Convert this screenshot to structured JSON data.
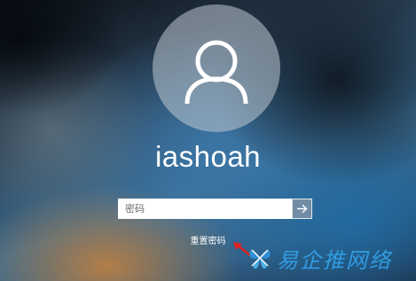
{
  "user": {
    "name": "iashoah",
    "avatar_icon": "user-silhouette-icon"
  },
  "login": {
    "password_placeholder": "密码",
    "password_value": "",
    "submit_icon": "arrow-right-icon",
    "reset_link_label": "重置密码"
  },
  "watermark": {
    "text": "易企推网络",
    "logo_icon": "butterfly-logo-icon",
    "color": "#32a0e6"
  },
  "annotation": {
    "pointer_icon": "red-arrow-icon",
    "color": "#e02020"
  }
}
